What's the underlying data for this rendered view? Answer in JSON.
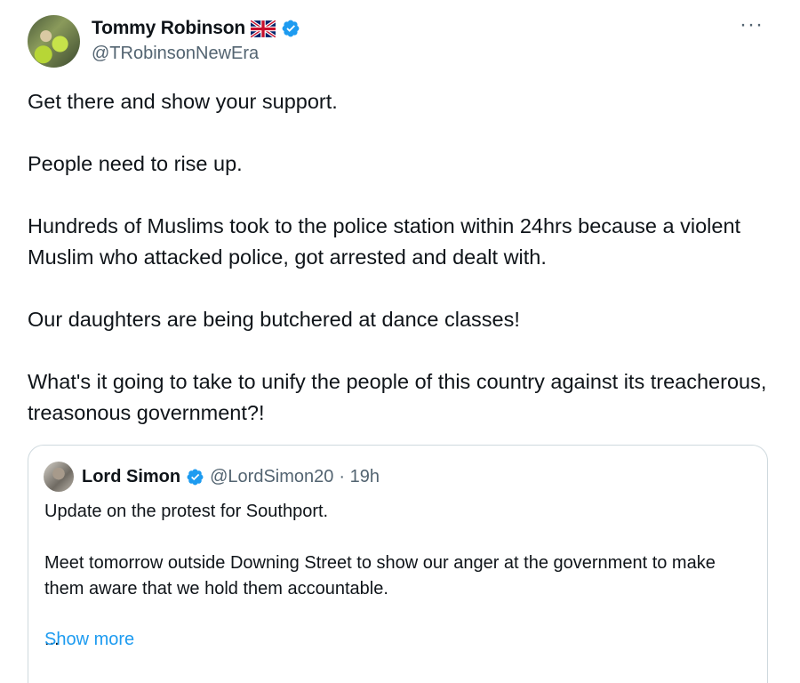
{
  "author": {
    "display_name": "Tommy Robinson",
    "flag_icon": "uk-flag-icon",
    "verified_icon": "verified-badge-icon",
    "handle": "@TRobinsonNewEra"
  },
  "more_icon": "more-options-icon",
  "more_label": "···",
  "tweet": {
    "paragraphs": [
      "Get there and show your support.",
      "People need to rise up.",
      "Hundreds of Muslims took to the police station within 24hrs because a violent Muslim who attacked police, got arrested and dealt with.",
      "Our daughters are being butchered at dance classes!",
      "What's it going to take to unify the people of this country against its treacherous, treasonous government?!"
    ]
  },
  "quoted": {
    "display_name": "Lord Simon",
    "handle": "@LordSimon20",
    "time": "· 19h",
    "paragraphs": [
      "Update on the protest for Southport.",
      "Meet tomorrow outside Downing Street to show our anger at the government to make them aware that we hold them accountable."
    ],
    "ellipsis": "...",
    "show_more": "Show more"
  },
  "colors": {
    "link_blue": "#1d9bf0",
    "secondary_text": "#536471",
    "border": "#cfd9de"
  }
}
